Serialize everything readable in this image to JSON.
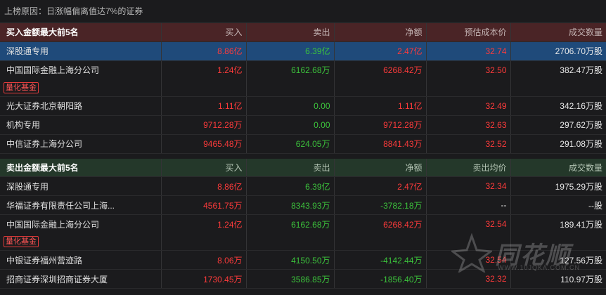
{
  "reason": "上榜原因：日涨幅偏离值达7%的证券",
  "buy": {
    "title": "买入金额最大前5名",
    "columns": [
      "买入",
      "卖出",
      "净额",
      "预估成本价",
      "成交数量"
    ],
    "rows": [
      {
        "name": "深股通专用",
        "buy": "8.86亿",
        "sell": "6.39亿",
        "net": "2.47亿",
        "price": "32.74",
        "vol": "2706.70万股"
      },
      {
        "name": "中国国际金融上海分公司",
        "buy": "1.24亿",
        "sell": "6162.68万",
        "net": "6268.42万",
        "price": "32.50",
        "vol": "382.47万股",
        "tag": "量化基金"
      },
      {
        "name": "光大证券北京朝阳路",
        "buy": "1.11亿",
        "sell": "0.00",
        "net": "1.11亿",
        "price": "32.49",
        "vol": "342.16万股"
      },
      {
        "name": "机构专用",
        "buy": "9712.28万",
        "sell": "0.00",
        "net": "9712.28万",
        "price": "32.63",
        "vol": "297.62万股"
      },
      {
        "name": "中信证券上海分公司",
        "buy": "9465.48万",
        "sell": "624.05万",
        "net": "8841.43万",
        "price": "32.52",
        "vol": "291.08万股"
      }
    ]
  },
  "sell": {
    "title": "卖出金额最大前5名",
    "columns": [
      "买入",
      "卖出",
      "净额",
      "卖出均价",
      "成交数量"
    ],
    "rows": [
      {
        "name": "深股通专用",
        "buy": "8.86亿",
        "sell": "6.39亿",
        "net": "2.47亿",
        "price": "32.34",
        "vol": "1975.29万股"
      },
      {
        "name": "华福证券有限责任公司上海...",
        "buy": "4561.75万",
        "sell": "8343.93万",
        "net": "-3782.18万",
        "price": "--",
        "vol": "--股"
      },
      {
        "name": "中国国际金融上海分公司",
        "buy": "1.24亿",
        "sell": "6162.68万",
        "net": "6268.42万",
        "price": "32.54",
        "vol": "189.41万股",
        "tag": "量化基金"
      },
      {
        "name": "中银证券福州营迹路",
        "buy": "8.06万",
        "sell": "4150.50万",
        "net": "-4142.44万",
        "price": "32.54",
        "vol": "127.56万股"
      },
      {
        "name": "招商证券深圳招商证券大厦",
        "buy": "1730.45万",
        "sell": "3586.85万",
        "net": "-1856.40万",
        "price": "32.32",
        "vol": "110.97万股"
      }
    ]
  },
  "watermark": {
    "brand": "同花顺",
    "url": "WWW.10JQKA.COM.CN"
  }
}
